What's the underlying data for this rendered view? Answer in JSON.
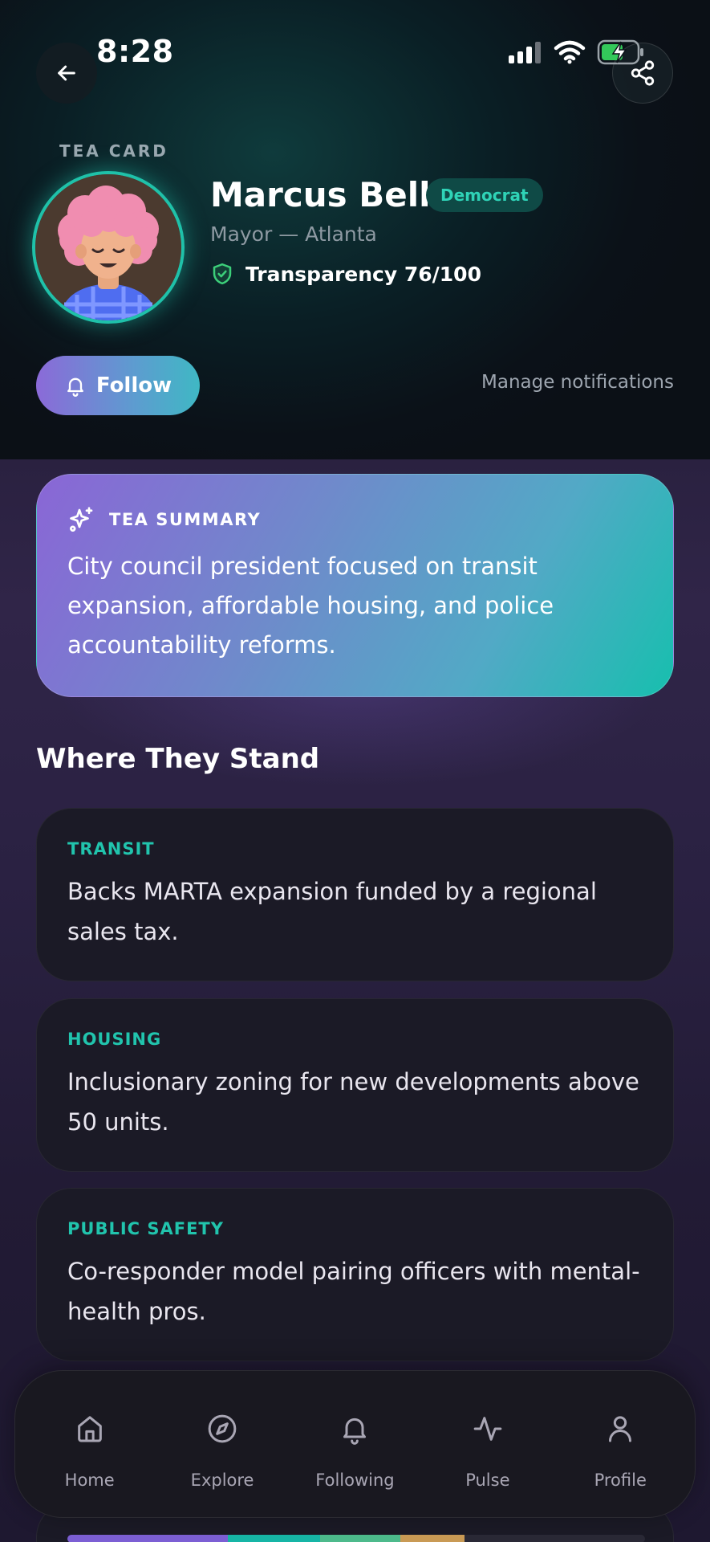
{
  "status_bar": {
    "time": "8:28"
  },
  "profile": {
    "eyebrow": "TEA CARD",
    "name": "Marcus Bell",
    "party": "Democrat",
    "role": "Mayor — Atlanta",
    "transparency_label": "Transparency 76/100",
    "transparency_score": 76
  },
  "actions": {
    "follow_label": "Follow",
    "manage_label": "Manage notifications"
  },
  "summary": {
    "title": "TEA SUMMARY",
    "text": "City council president focused on transit expansion, affordable housing, and police accountability reforms."
  },
  "stances": {
    "title": "Where They Stand",
    "items": [
      {
        "topic": "TRANSIT",
        "text": "Backs MARTA expansion funded by a regional sales tax."
      },
      {
        "topic": "HOUSING",
        "text": "Inclusionary zoning for new developments above 50 units."
      },
      {
        "topic": "PUBLIC SAFETY",
        "text": "Co-responder model pairing officers with mental-health pros."
      }
    ]
  },
  "tabbar": {
    "items": [
      {
        "label": "Home",
        "icon": "home-icon"
      },
      {
        "label": "Explore",
        "icon": "compass-icon"
      },
      {
        "label": "Following",
        "icon": "bell-icon"
      },
      {
        "label": "Pulse",
        "icon": "pulse-icon"
      },
      {
        "label": "Profile",
        "icon": "user-icon"
      }
    ]
  },
  "colors": {
    "accent_teal": "#21c4ad",
    "accent_purple": "#8b6ad8",
    "card_bg": "#1b1a26",
    "page_bg": "#221c35"
  }
}
